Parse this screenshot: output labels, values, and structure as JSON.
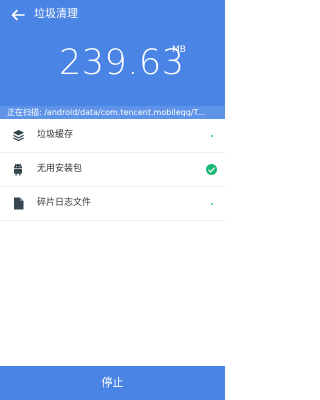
{
  "header": {
    "title": "垃圾清理",
    "size_value": "239.63",
    "size_unit": "MB"
  },
  "scan": {
    "text": "正在扫描: /android/data/com.tencent.mobileqq/T..."
  },
  "categories": [
    {
      "label": "垃圾缓存",
      "icon": "layers-icon",
      "status": "scanning"
    },
    {
      "label": "无用安装包",
      "icon": "android-icon",
      "status": "done"
    },
    {
      "label": "碎片日志文件",
      "icon": "file-icon",
      "status": "scanning"
    }
  ],
  "footer": {
    "stop_label": "停止"
  },
  "colors": {
    "primary": "#4a84e5",
    "scan_bar": "#5f93e8",
    "success": "#18b774"
  }
}
